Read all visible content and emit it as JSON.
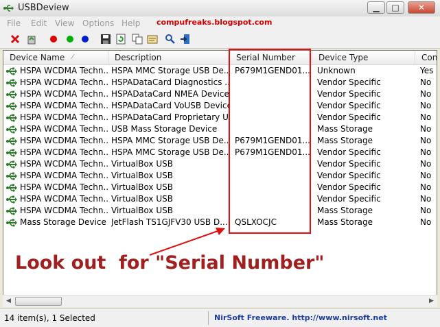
{
  "window": {
    "title": "USBDeview"
  },
  "menu": [
    "File",
    "Edit",
    "View",
    "Options",
    "Help"
  ],
  "blog_url": "compufreaks.blogspot.com",
  "toolbar_icons": [
    "delete-icon",
    "recycle-icon",
    "red-dot-icon",
    "green-dot-icon",
    "blue-dot-icon",
    "save-icon",
    "refresh-icon",
    "copy-icon",
    "properties-icon",
    "find-icon",
    "exit-icon"
  ],
  "columns": [
    "Device Name",
    "Description",
    "Serial Number",
    "Device Type",
    "Con"
  ],
  "rows": [
    {
      "name": "HSPA WCDMA Techn...",
      "desc": "HSPA MMC Storage USB De...",
      "serial": "P679M1GEND01...",
      "type": "Unknown",
      "con": "Yes"
    },
    {
      "name": "HSPA WCDMA Techn...",
      "desc": "HSPADataCard Diagnostics ...",
      "serial": "",
      "type": "Vendor Specific",
      "con": "No"
    },
    {
      "name": "HSPA WCDMA Techn...",
      "desc": "HSPADataCard NMEA Device",
      "serial": "",
      "type": "Vendor Specific",
      "con": "No"
    },
    {
      "name": "HSPA WCDMA Techn...",
      "desc": "HSPADataCard VoUSB Device",
      "serial": "",
      "type": "Vendor Specific",
      "con": "No"
    },
    {
      "name": "HSPA WCDMA Techn...",
      "desc": "HSPADataCard Proprietary U...",
      "serial": "",
      "type": "Vendor Specific",
      "con": "No"
    },
    {
      "name": "HSPA WCDMA Techn...",
      "desc": "USB Mass Storage Device",
      "serial": "",
      "type": "Mass Storage",
      "con": "No"
    },
    {
      "name": "HSPA WCDMA Techn...",
      "desc": "HSPA MMC Storage USB De...",
      "serial": "P679M1GEND01...",
      "type": "Mass Storage",
      "con": "No"
    },
    {
      "name": "HSPA WCDMA Techn...",
      "desc": "HSPA MMC Storage USB De...",
      "serial": "P679M1GEND01...",
      "type": "Vendor Specific",
      "con": "No"
    },
    {
      "name": "HSPA WCDMA Techn...",
      "desc": "VirtualBox USB",
      "serial": "",
      "type": "Vendor Specific",
      "con": "No"
    },
    {
      "name": "HSPA WCDMA Techn...",
      "desc": "VirtualBox USB",
      "serial": "",
      "type": "Vendor Specific",
      "con": "No"
    },
    {
      "name": "HSPA WCDMA Techn...",
      "desc": "VirtualBox USB",
      "serial": "",
      "type": "Vendor Specific",
      "con": "No"
    },
    {
      "name": "HSPA WCDMA Techn...",
      "desc": "VirtualBox USB",
      "serial": "",
      "type": "Vendor Specific",
      "con": "No"
    },
    {
      "name": "HSPA WCDMA Techn...",
      "desc": "VirtualBox USB",
      "serial": "",
      "type": "Mass Storage",
      "con": "No"
    },
    {
      "name": "Mass Storage Device",
      "desc": "JetFlash TS1GJFV30 USB D...",
      "serial": "QSLXOCJC",
      "type": "Mass Storage",
      "con": "No"
    }
  ],
  "status": {
    "left": "14 item(s), 1 Selected",
    "right": "NirSoft Freeware.  http://www.nirsoft.net"
  },
  "annotation": "Look out  for \"Serial Number\"",
  "colors": {
    "highlight_box": "#e01010",
    "annotation": "#a02020",
    "blog": "#d00000"
  }
}
